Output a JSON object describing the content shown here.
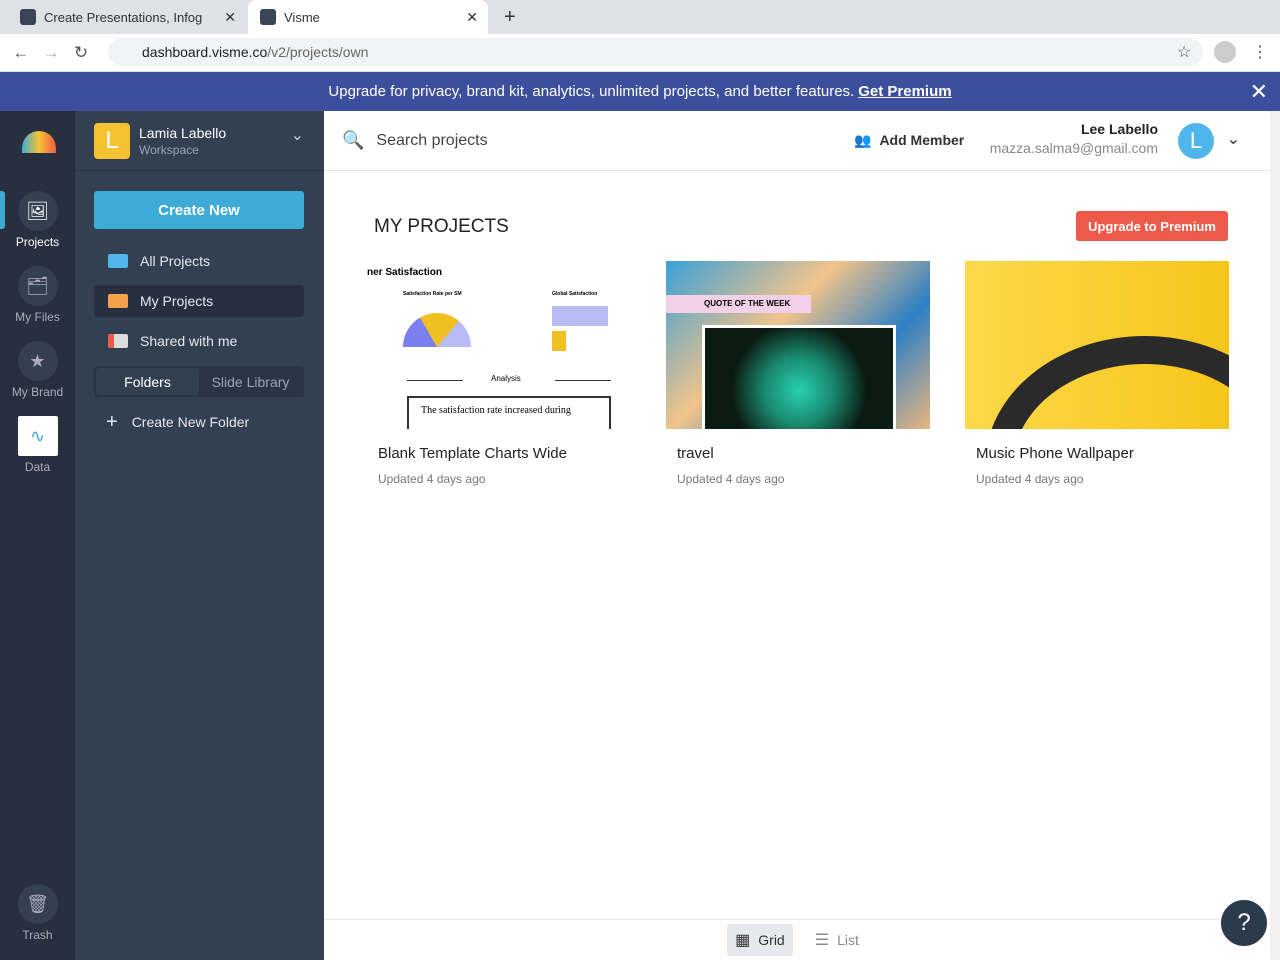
{
  "browser": {
    "tabs": [
      {
        "title": "Create Presentations, Infog"
      },
      {
        "title": "Visme"
      }
    ],
    "url_host": "dashboard.visme.co",
    "url_path": "/v2/projects/own"
  },
  "banner": {
    "text": "Upgrade for privacy, brand kit, analytics, unlimited projects, and better features.",
    "link": "Get Premium"
  },
  "rail": [
    {
      "label": "Projects"
    },
    {
      "label": "My Files"
    },
    {
      "label": "My Brand"
    },
    {
      "label": "Data"
    },
    {
      "label": "Trash"
    }
  ],
  "workspace": {
    "initial": "L",
    "name": "Lamia Labello",
    "sub": "Workspace"
  },
  "sidebar": {
    "create": "Create New",
    "items": [
      {
        "label": "All Projects"
      },
      {
        "label": "My Projects"
      },
      {
        "label": "Shared with me"
      }
    ],
    "seg": [
      "Folders",
      "Slide Library"
    ],
    "new_folder": "Create New Folder"
  },
  "topbar": {
    "search_placeholder": "Search projects",
    "add_member": "Add Member",
    "user_name": "Lee Labello",
    "user_email": "mazza.salma9@gmail.com",
    "user_initial": "L"
  },
  "main": {
    "title": "MY PROJECTS",
    "upgrade": "Upgrade to Premium",
    "projects": [
      {
        "title": "Blank Template Charts Wide",
        "updated": "Updated 4 days ago",
        "thumb_heading": "ner Satisfaction",
        "thumb_c1": "Satisfaction Rate per SM",
        "thumb_c2": "Global Satisfaction",
        "thumb_mid": "Analysis",
        "thumb_box": "The satisfaction rate increased during"
      },
      {
        "title": "travel",
        "updated": "Updated 4 days ago",
        "thumb_label": "QUOTE OF THE WEEK"
      },
      {
        "title": "Music Phone Wallpaper",
        "updated": "Updated 4 days ago"
      }
    ]
  },
  "view": {
    "grid": "Grid",
    "list": "List"
  },
  "help": "?"
}
